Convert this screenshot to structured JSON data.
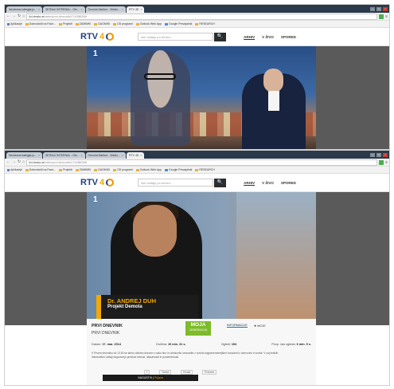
{
  "browser": {
    "tabs": [
      {
        "label": "Neodrana kategija ju..."
      },
      {
        "label": "SEITech INTERNAL - Otv..."
      },
      {
        "label": "Demola Maribor - Mediu..."
      },
      {
        "label": "RTV 4D"
      }
    ],
    "url_host": "4d.rtvslo.si",
    "url_path": "/arhiv/prvi-dnevnik/174286356",
    "bookmarks": [
      {
        "label": "Aplikacije",
        "icon": "apps-icon"
      },
      {
        "label": "Dobrodošli na Face..."
      },
      {
        "label": "Projekti"
      },
      {
        "label": "ZAMIMKI"
      },
      {
        "label": "DAGMIKI"
      },
      {
        "label": "CB programi"
      },
      {
        "label": "Outlook Web App"
      },
      {
        "label": "Google Prevajalnik",
        "icon": "google-icon"
      },
      {
        "label": "RESEARCH"
      }
    ]
  },
  "site": {
    "logo": "RTV",
    "logo_num": "4",
    "search_placeholder": "Išči oddajo po arhivu...",
    "search_button_glyph": "🔍",
    "nav": [
      {
        "label": "ARHIV",
        "active": true
      },
      {
        "label": "V ŽIVO",
        "active": false
      },
      {
        "label": "SPORED",
        "active": false
      }
    ],
    "channel": "1"
  },
  "caption": {
    "name": "Dr. ANDREJ DUH",
    "project": "Projekt Demola"
  },
  "show": {
    "title": "PRVI DNEVNIK",
    "subtitle": "PRVI DNEVNIK",
    "badge_main": "MOJA",
    "badge_sub": "GENERACIJA",
    "tab_info": "INFORMACIJE",
    "tab_fav": "MOJE",
    "date_label": "Datum:",
    "date_value": "17. mar. 2014",
    "duration_label": "Dolžina:",
    "duration_value": "19 min. 31 s.",
    "views_label": "Ogledi:",
    "views_value": "194",
    "watched_label": "Povp. čas ogleda:",
    "watched_value": "6 min. 9 s.",
    "description": "V Prvem dnevniku ob 13.00 se lahko dobimo dnevne z našo hiro in učinkovito seznanite z novimi najpomembnejšimi novicami iz domovine in sveta. V naj kratkih informativni oddaji dogovorejo predlozi televizi, aktualnosti in pomembnosti.",
    "share": [
      "f",
      "Tweet",
      "Email",
      "Prenesi"
    ],
    "overlay_prefix": "NAGUSTVI",
    "overlay_link": "Prijava"
  },
  "colors": {
    "accent": "#f2a900",
    "brand_blue": "#1d3f86",
    "badge_green": "#7dbb2a"
  }
}
